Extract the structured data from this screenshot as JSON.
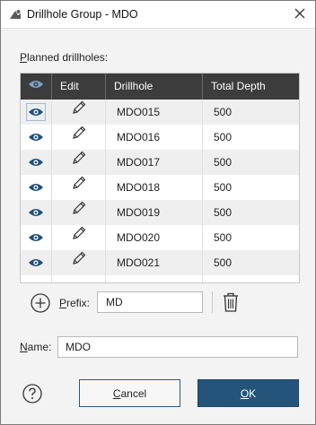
{
  "window": {
    "title": "Drillhole Group - MDO"
  },
  "planned": {
    "label_key": "P",
    "label_rest": "lanned drillholes:"
  },
  "table": {
    "headers": {
      "edit": "Edit",
      "drillhole": "Drillhole",
      "total_depth": "Total Depth"
    },
    "rows": [
      {
        "drillhole": "MDO015",
        "total_depth": "500"
      },
      {
        "drillhole": "MDO016",
        "total_depth": "500"
      },
      {
        "drillhole": "MDO017",
        "total_depth": "500"
      },
      {
        "drillhole": "MDO018",
        "total_depth": "500"
      },
      {
        "drillhole": "MDO019",
        "total_depth": "500"
      },
      {
        "drillhole": "MDO020",
        "total_depth": "500"
      },
      {
        "drillhole": "MDO021",
        "total_depth": "500"
      }
    ]
  },
  "prefix": {
    "label_key": "P",
    "label_rest": "refix:",
    "value": "MD"
  },
  "name": {
    "label_key": "N",
    "label_rest": "ame:",
    "value": "MDO"
  },
  "buttons": {
    "cancel_key": "C",
    "cancel_rest": "ancel",
    "ok_key": "O",
    "ok_rest": "K"
  },
  "colors": {
    "accent": "#245479",
    "header_bg": "#3c3c3c",
    "icon_blue": "#1f4e79"
  },
  "icons": {
    "app": "leapfrog-app-icon",
    "close": "close-icon",
    "visibility": "eye-icon",
    "edit": "pencil-icon",
    "add": "plus-circle-icon",
    "delete": "trash-icon",
    "help": "help-icon"
  }
}
